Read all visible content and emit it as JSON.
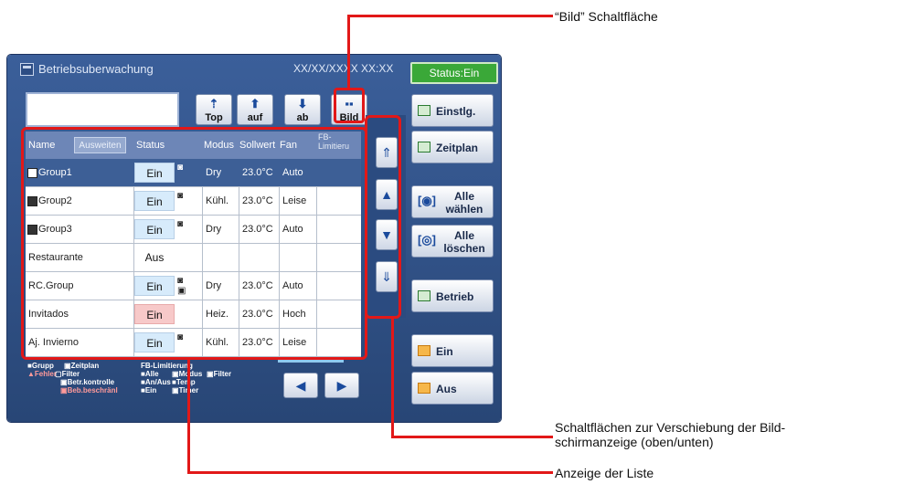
{
  "window": {
    "title": "Betriebsuberwachung",
    "datetime": "XX/XX/XXXX  XX:XX",
    "status": "Status:Ein"
  },
  "toolbar": {
    "top": "Top",
    "auf": "auf",
    "ab": "ab",
    "bild": "Bild"
  },
  "right_buttons": {
    "einstlg": "Einstlg.",
    "zeitplan": "Zeitplan",
    "alle_waehlen_1": "Alle",
    "alle_waehlen_2": "wählen",
    "alle_loeschen_1": "Alle",
    "alle_loeschen_2": "löschen",
    "betrieb": "Betrieb",
    "ein": "Ein",
    "aus": "Aus"
  },
  "table": {
    "headers": {
      "name": "Name",
      "ausweiten": "Ausweiten",
      "status": "Status",
      "modus": "Modus",
      "sollwert": "Sollwert",
      "fan": "Fan",
      "fb_1": "FB-",
      "fb_2": "Limitieru"
    },
    "rows": [
      {
        "name": "Group1",
        "status": "Ein",
        "modus": "Dry",
        "sollwert": "23.0°C",
        "fan": "Auto"
      },
      {
        "name": "Group2",
        "status": "Ein",
        "modus": "Kühl.",
        "sollwert": "23.0°C",
        "fan": "Leise"
      },
      {
        "name": "Group3",
        "status": "Ein",
        "modus": "Dry",
        "sollwert": "23.0°C",
        "fan": "Auto"
      },
      {
        "name": "Restaurante",
        "status": "Aus",
        "modus": "",
        "sollwert": "",
        "fan": ""
      },
      {
        "name": "RC.Group",
        "status": "Ein",
        "modus": "Dry",
        "sollwert": "23.0°C",
        "fan": "Auto"
      },
      {
        "name": "Invitados",
        "status": "Ein",
        "modus": "Heiz.",
        "sollwert": "23.0°C",
        "fan": "Hoch"
      },
      {
        "name": "Aj. Invierno",
        "status": "Ein",
        "modus": "Kühl.",
        "sollwert": "23.0°C",
        "fan": "Leise"
      }
    ]
  },
  "legend": {
    "grupp": "Grupp",
    "zeitplan": "Zeitplan",
    "fehler": "Fehler",
    "filter": "Filter",
    "betr_kontrolle": "Betr.kontrolle",
    "beb_beschraenl": "Beb.beschränl",
    "fb_limitierung": "FB-Limitierung",
    "alle": "Alle",
    "modus": "Modus",
    "filter2": "Filter",
    "an_aus": "An/Aus",
    "temp": "Temp",
    "ein": "Ein",
    "timer": "Timer"
  },
  "annotations": {
    "bild": "“Bild” Schaltfläche",
    "scroll_1": "Schaltflächen zur Verschiebung der Bild-",
    "scroll_2": "schirmanzeige (oben/unten)",
    "list": "Anzeige der Liste"
  },
  "colors": {
    "annotation_red": "#e21818",
    "status_green": "#3aa838",
    "screen_blue": "#2f5089",
    "selected_row": "#3d5f96"
  }
}
